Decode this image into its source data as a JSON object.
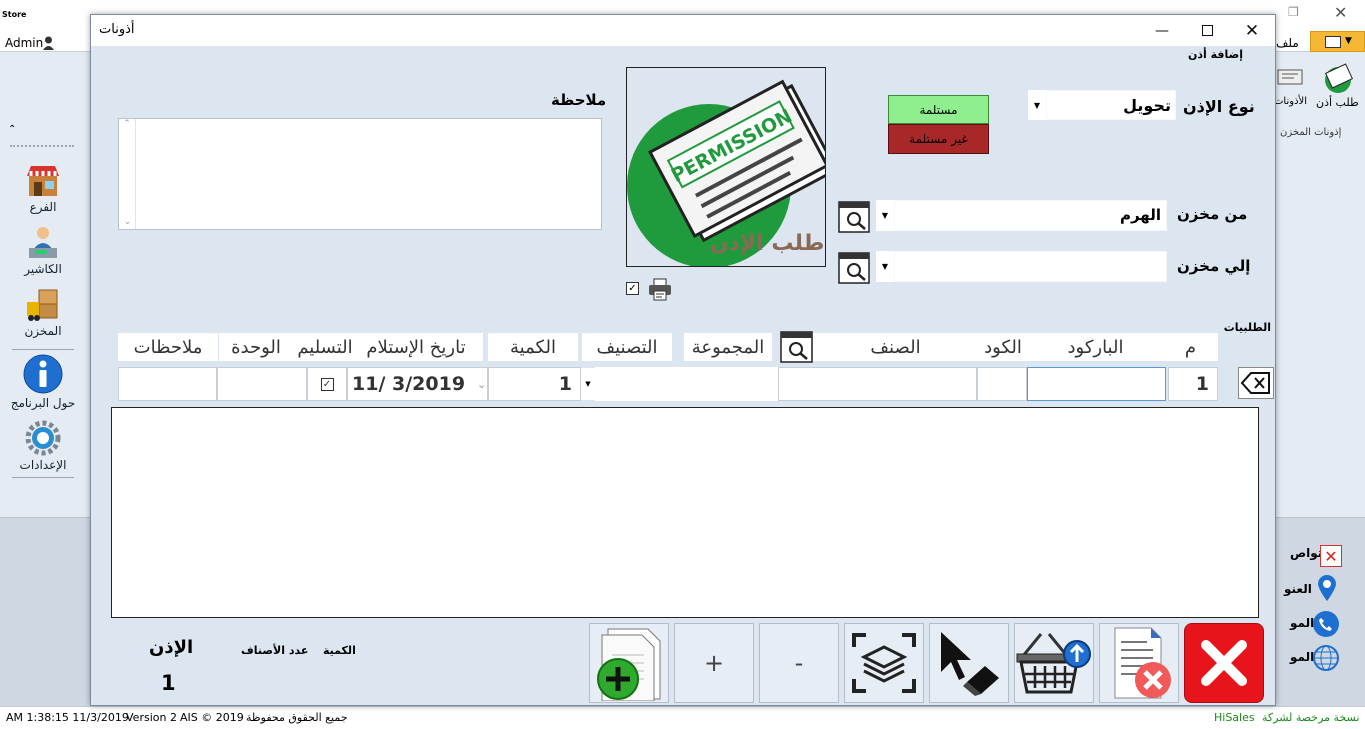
{
  "app": {
    "admin_label": "Admin",
    "logo_text": "Store",
    "top_menu_file": "ملف",
    "ribbon": {
      "request_permission": "طلب أذن",
      "permissions": "الأذونات",
      "group_label": "إذونات المخزن"
    },
    "sidebar": {
      "items": [
        {
          "label": "الفرع",
          "icon": "shop-icon"
        },
        {
          "label": "الكاشير",
          "icon": "cashier-icon"
        },
        {
          "label": "المخزن",
          "icon": "warehouse-icon"
        },
        {
          "label": "حول البرنامج",
          "icon": "info-icon"
        },
        {
          "label": "الإعدادات",
          "icon": "settings-icon"
        }
      ]
    },
    "right_panel": {
      "items": [
        "تواص",
        "العنو",
        "المو",
        "المو"
      ]
    },
    "status_bar": {
      "datetime": "AM 1:38:15 11/3/2019",
      "version": "Version 2",
      "copyright": "AIS © 2019",
      "rights": "جميع الحقوق محفوظة",
      "brand": "HiSales",
      "license": "نسخة مرخصة لشركة"
    }
  },
  "dialog": {
    "title": "أذونات",
    "section_label": "إضافة أذن",
    "permission_type_label": "نوع الإذن",
    "permission_type_value": "تحويل",
    "received_button": "مستلمة",
    "not_received_button": "غير مستلمة",
    "from_store_label": "من مخزن",
    "from_store_value": "الهرم",
    "to_store_label": "إلي مخزن",
    "to_store_value": "",
    "note_label": "ملاحظة",
    "note_value": "",
    "logo_text": "PERMISSION",
    "logo_caption": "طلب الإذن",
    "requests_label": "الطلبيات",
    "columns": {
      "index": "م",
      "barcode": "الباركود",
      "code": "الكود",
      "item": "الصنف",
      "group": "المجموعة",
      "category": "التصنيف",
      "quantity": "الكمية",
      "receive_date": "تاريخ الإستلام",
      "delivery": "التسليم",
      "unit": "الوحدة",
      "notes": "ملاحظات"
    },
    "entry": {
      "index": "1",
      "barcode": "",
      "code": "",
      "item": "",
      "category": "",
      "quantity": "1",
      "date": "11/  3/2019",
      "delivered": true,
      "unit": "",
      "notes": ""
    },
    "footer": {
      "permission_label": "الإذن",
      "permission_number": "1",
      "items_count_label": "عدد الأصناف",
      "quantity_label": "الكمية",
      "plus_label": "+",
      "minus_label": "-"
    }
  },
  "colors": {
    "received_bg": "#8fef8f",
    "not_received_bg": "#a8282a",
    "close_red": "#e8141c",
    "logo_green": "#1f9a3c",
    "status_green": "#1a8a1a"
  }
}
